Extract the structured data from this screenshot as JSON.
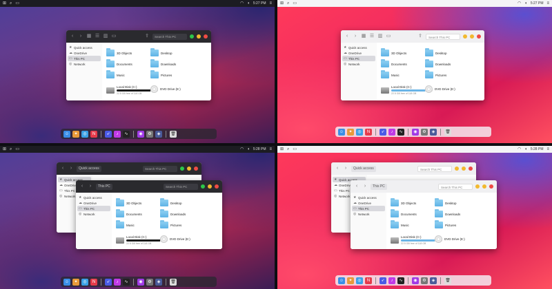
{
  "menubar": {
    "dark_clock": "5:27 PM",
    "light_clock": "5:27 PM",
    "bottom_clock": "5:28 PM",
    "bottom_light_clock": "5:28 PM"
  },
  "finder": {
    "path_label": "This PC",
    "search_placeholder": "Search This PC",
    "sidebar": [
      {
        "label": "Quick access",
        "icon": "star-icon"
      },
      {
        "label": "OneDrive",
        "icon": "cloud-icon"
      },
      {
        "label": "This PC",
        "icon": "computer-icon",
        "selected": true
      },
      {
        "label": "Network",
        "icon": "network-icon"
      }
    ],
    "folders": [
      {
        "label": "3D Objects"
      },
      {
        "label": "Desktop"
      },
      {
        "label": "Documents"
      },
      {
        "label": "Downloads"
      },
      {
        "label": "Music"
      },
      {
        "label": "Pictures"
      }
    ],
    "drive": {
      "label": "Local Disk (C:)",
      "free": "22.5 GB free of 118 GB",
      "usage_fraction": 0.81
    },
    "dvd": {
      "label": "DVD Drive (E:)"
    }
  },
  "dock": {
    "icons": [
      "finder-icon",
      "launchpad-icon",
      "safari-icon",
      "news-icon",
      "rocket-icon",
      "itunes-icon",
      "activity-icon",
      "podcasts-icon",
      "settings-icon",
      "shield-icon",
      "trash-icon"
    ]
  },
  "colors": {
    "dark_titlebar": "#2a2a2e",
    "light_titlebar": "#f0f0f2",
    "folder_blue": "#5eb3e6",
    "close": "#ef4b45",
    "minimize": "#f2b92f",
    "zoom": "#2dc74a"
  }
}
